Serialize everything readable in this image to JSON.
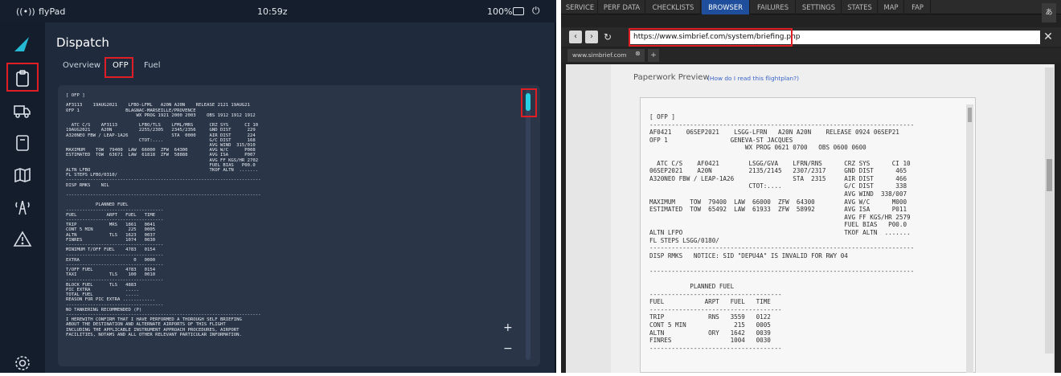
{
  "flypad": {
    "status": {
      "app": "flyPad",
      "time": "10:59z",
      "battery": "100%"
    },
    "title": "Dispatch",
    "tabs": [
      {
        "label": "Overview"
      },
      {
        "label": "OFP"
      },
      {
        "label": "Fuel"
      }
    ],
    "ofp_text": "[ OFP ]\n\nAF3113    19AUG2021    LFBO-LFML   A20N A20N    RELEASE 2121 19AUG21\nOFP 1                 BLAGNAC-MARSEILLE/PROVENCE\n                          WX PROG 1921 2000 2003    OBS 1912 1912 1912\n\n  ATC C/S    AF3113        LFBO/TLS    LFML/MRS      CRZ SYS      CI 10\n19AUG2021    A20N          2255/2305   2345/2356     GND DIST      229\nA320NEO FBW / LEAP-1A26                STA  0000     AIR DIST      224\n                           CTOT:....                 G/C DIST      168\n                                                     AVG WIND  315/010\nMAXIMUM    TOW  79400  LAW  66000  ZFW  64300        AVG W/C      P008\nESTIMATED  TOW  63671  LAW  61818  ZFW  58888        AVG ISA      P007\n                                                     AVG FF KGS/HR 2702\n                                                     FUEL BIAS   P00.0\nALTN LFBO                                            TKOF ALTN  .......\nFL STEPS LFBO/0310/\n------------------------------------------------------------------------\nDISP RMKS    NIL\n\n------------------------------------------------------------------------\n\n           PLANNED FUEL\n------------------------------------\nFUEL           ARPT   FUEL   TIME\n------------------------------------\nTRIP            MRS   1861   0041\nCONT 5 MIN             225   0005\nALTN            TLS   1623   0037\nFINRES                1074   0030\n------------------------------------\nMINIMUM T/OFF FUEL    4783   0154\n------------------------------------\nEXTRA                    0   0000\n------------------------------------\nT/OFF FUEL            4783   0154\nTAXI            TLS    100   0010\n------------------------------------\nBLOCK FUEL      TLS   4883\nPIC EXTRA             .....\nTOTAL FUEL            .....\nREASON FOR PIC EXTRA ............\n------------------------------------\nNO TANKERING RECOMMENDED (P)\n------------------------------------------------------------------------\nI HEREWITH CONFIRM THAT I HAVE PERFORMED A THOROUGH SELF BRIEFING\nABOUT THE DESTINATION AND ALTERNATE AIRPORTS OF THIS FLIGHT\nINCLUDING THE APPLICABLE INSTRUMENT APPROACH PROCEDURES, AIRPORT\nFACILITIES, NOTAMS AND ALL OTHER RELEVANT PARTICULAR INFORMATION.",
    "zoom_in": "+",
    "zoom_out": "−"
  },
  "browser": {
    "menu": [
      {
        "label": "SERVICE"
      },
      {
        "label": "PERF DATA"
      },
      {
        "label": "CHECKLISTS"
      },
      {
        "label": "BROWSER"
      },
      {
        "label": "FAILURES"
      },
      {
        "label": "SETTINGS"
      },
      {
        "label": "STATES"
      },
      {
        "label": "MAP"
      },
      {
        "label": "FAP"
      }
    ],
    "url": "https://www.simbrief.com/system/briefing.php",
    "tab_label": "www.simbrief.com",
    "new_tab": "+",
    "back": "‹",
    "forward": "›",
    "reload": "↻",
    "close": "✕",
    "corner_glyph": "あ",
    "preview_title": "Paperwork Preview",
    "preview_link": "(How do I read this flightplan?)",
    "doc_text": "[ OFP ]\n------------------------------------------------------------------------\nAF0421    06SEP2021    LSGG-LFRN   A20N A20N    RELEASE 0924 06SEP21\nOFP 1                 GENEVA-ST JACQUES\n                          WX PROG 0621 0700   OBS 0600 0600\n\n  ATC C/S    AF0421        LSGG/GVA    LFRN/RNS      CRZ SYS      CI 10\n06SEP2021    A20N          2135/2145   2307/2317     GND DIST      465\nA320NEO FBW / LEAP-1A26                STA  2315     AIR DIST      466\n                           CTOT:....                 G/C DIST      338\n                                                     AVG WIND  338/007\nMAXIMUM    TOW  79400  LAW  66000  ZFW  64300        AVG W/C      M000\nESTIMATED  TOW  65492  LAW  61933  ZFW  58992        AVG ISA      P011\n                                                     AVG FF KGS/HR 2579\n                                                     FUEL BIAS   P00.0\nALTN LFPO                                            TKOF ALTN  .......\nFL STEPS LSGG/0180/\n------------------------------------------------------------------------\nDISP RMKS   NOTICE: SID \"DEPU4A\" IS INVALID FOR RWY 04\n\n------------------------------------------------------------------------\n\n           PLANNED FUEL\n------------------------------------\nFUEL           ARPT   FUEL   TIME\n------------------------------------\nTRIP            RNS   3559   0122\nCONT 5 MIN             215   0005\nALTN            ORY   1642   0039\nFINRES                1004   0030\n------------------------------------"
  },
  "colors": {
    "highlight": "#e01e26",
    "accent": "#26d3e6",
    "browser_active": "#1f4f9c"
  }
}
